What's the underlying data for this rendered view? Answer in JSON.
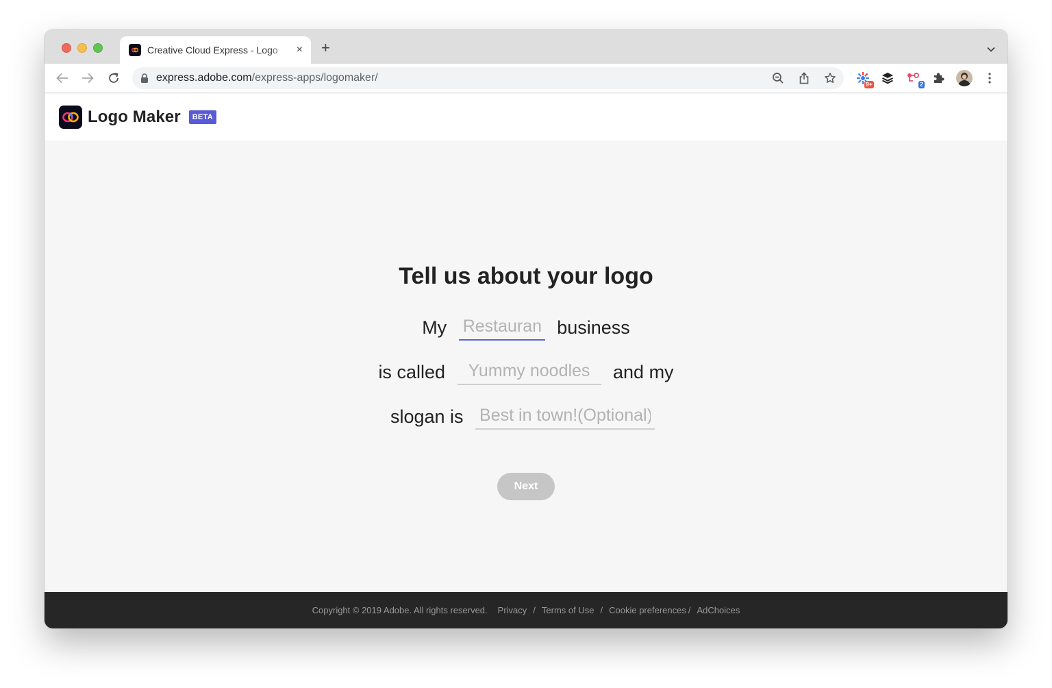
{
  "browser": {
    "tab_title": "Creative Cloud Express - Logo",
    "new_tab_label": "+",
    "close_label": "×",
    "url_host": "express.adobe.com",
    "url_path": "/express-apps/logomaker/",
    "extension_badges": {
      "first": "9+",
      "second": "2"
    }
  },
  "app": {
    "title": "Logo Maker",
    "badge": "BETA"
  },
  "form": {
    "heading": "Tell us about your logo",
    "row1_prefix": "My",
    "row1_suffix": "business",
    "business_type_placeholder": "Restaurant",
    "row2_prefix": "is called",
    "row2_suffix": "and my",
    "business_name_placeholder": "Yummy noodles",
    "row3_prefix": "slogan is",
    "slogan_placeholder": "Best in town!(Optional)",
    "next_label": "Next"
  },
  "footer": {
    "copyright": "Copyright © 2019 Adobe. All rights reserved.",
    "privacy": "Privacy",
    "terms": "Terms of Use",
    "cookies": "Cookie preferences",
    "adchoices": "AdChoices",
    "separator": "/"
  },
  "colors": {
    "accent": "#5468d6",
    "beta_badge": "#5a5ad6",
    "button_disabled": "#c6c6c6",
    "footer_bg": "#262626"
  },
  "icons": [
    "back-arrow-icon",
    "forward-arrow-icon",
    "reload-icon",
    "lock-icon",
    "zoom-icon",
    "share-icon",
    "bookmark-star-icon",
    "puzzle-extensions-icon",
    "profile-avatar",
    "kebab-menu-icon",
    "chevron-down-icon"
  ]
}
